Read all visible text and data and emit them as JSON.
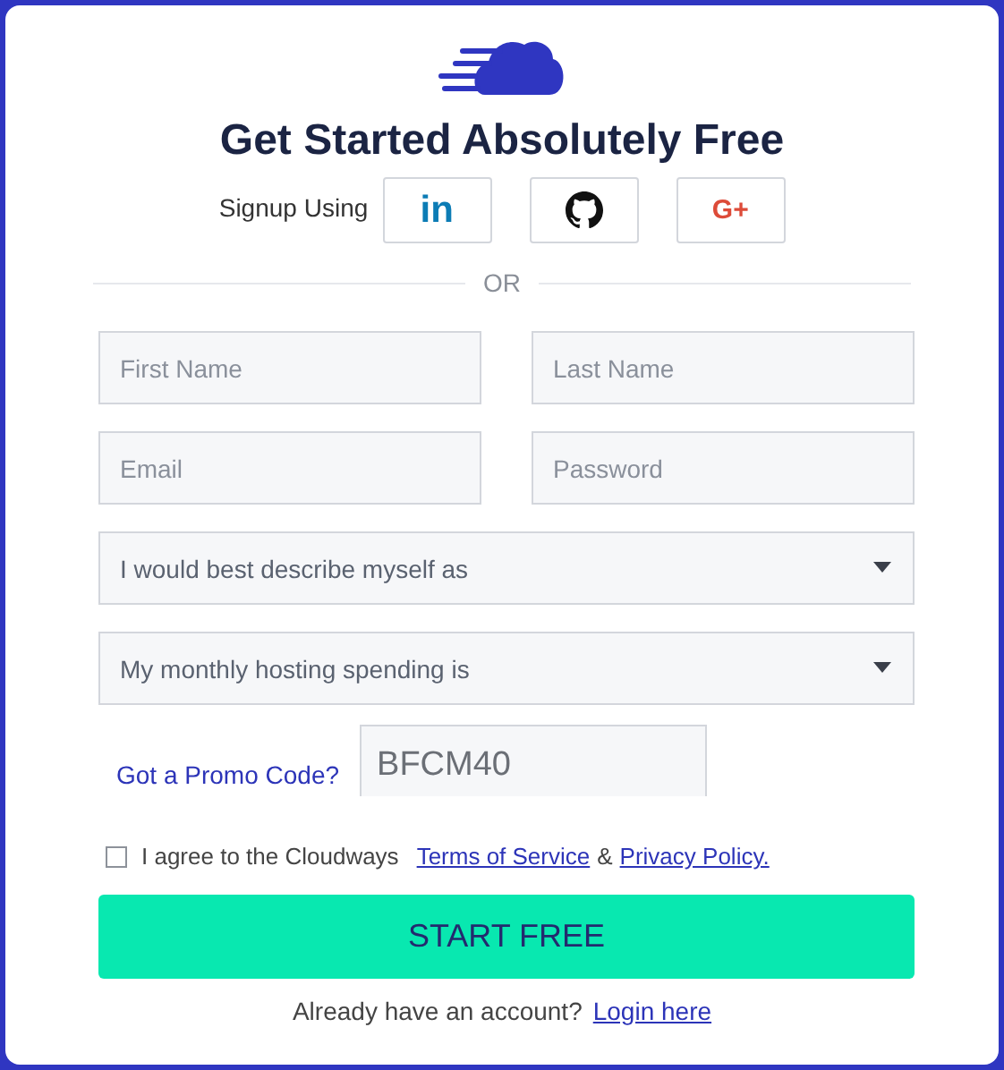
{
  "title": "Get Started Absolutely Free",
  "signup_label": "Signup Using",
  "social_buttons": [
    {
      "kind": "linkedin",
      "label": "in"
    },
    {
      "kind": "github"
    },
    {
      "kind": "google",
      "label": "G+"
    }
  ],
  "divider": "OR",
  "fields": [
    {
      "kind": "input",
      "placeholder": "First Name"
    },
    {
      "kind": "input",
      "placeholder": "Last Name"
    },
    {
      "kind": "input",
      "placeholder": "Email"
    },
    {
      "kind": "input",
      "placeholder": "Password"
    },
    {
      "kind": "select",
      "placeholder": "I would best describe myself as"
    },
    {
      "kind": "select",
      "placeholder": "My monthly hosting spending is"
    }
  ],
  "promo": {
    "label": "Got a Promo Code?",
    "value": "BFCM40"
  },
  "agree": {
    "checked": false,
    "text": "I agree to the Cloudways",
    "terms_link": "Terms of Service",
    "joiner": "&",
    "privacy_link": "Privacy Policy."
  },
  "submit": "START FREE",
  "login": {
    "text": "Already have an account?",
    "link": "Login here"
  }
}
